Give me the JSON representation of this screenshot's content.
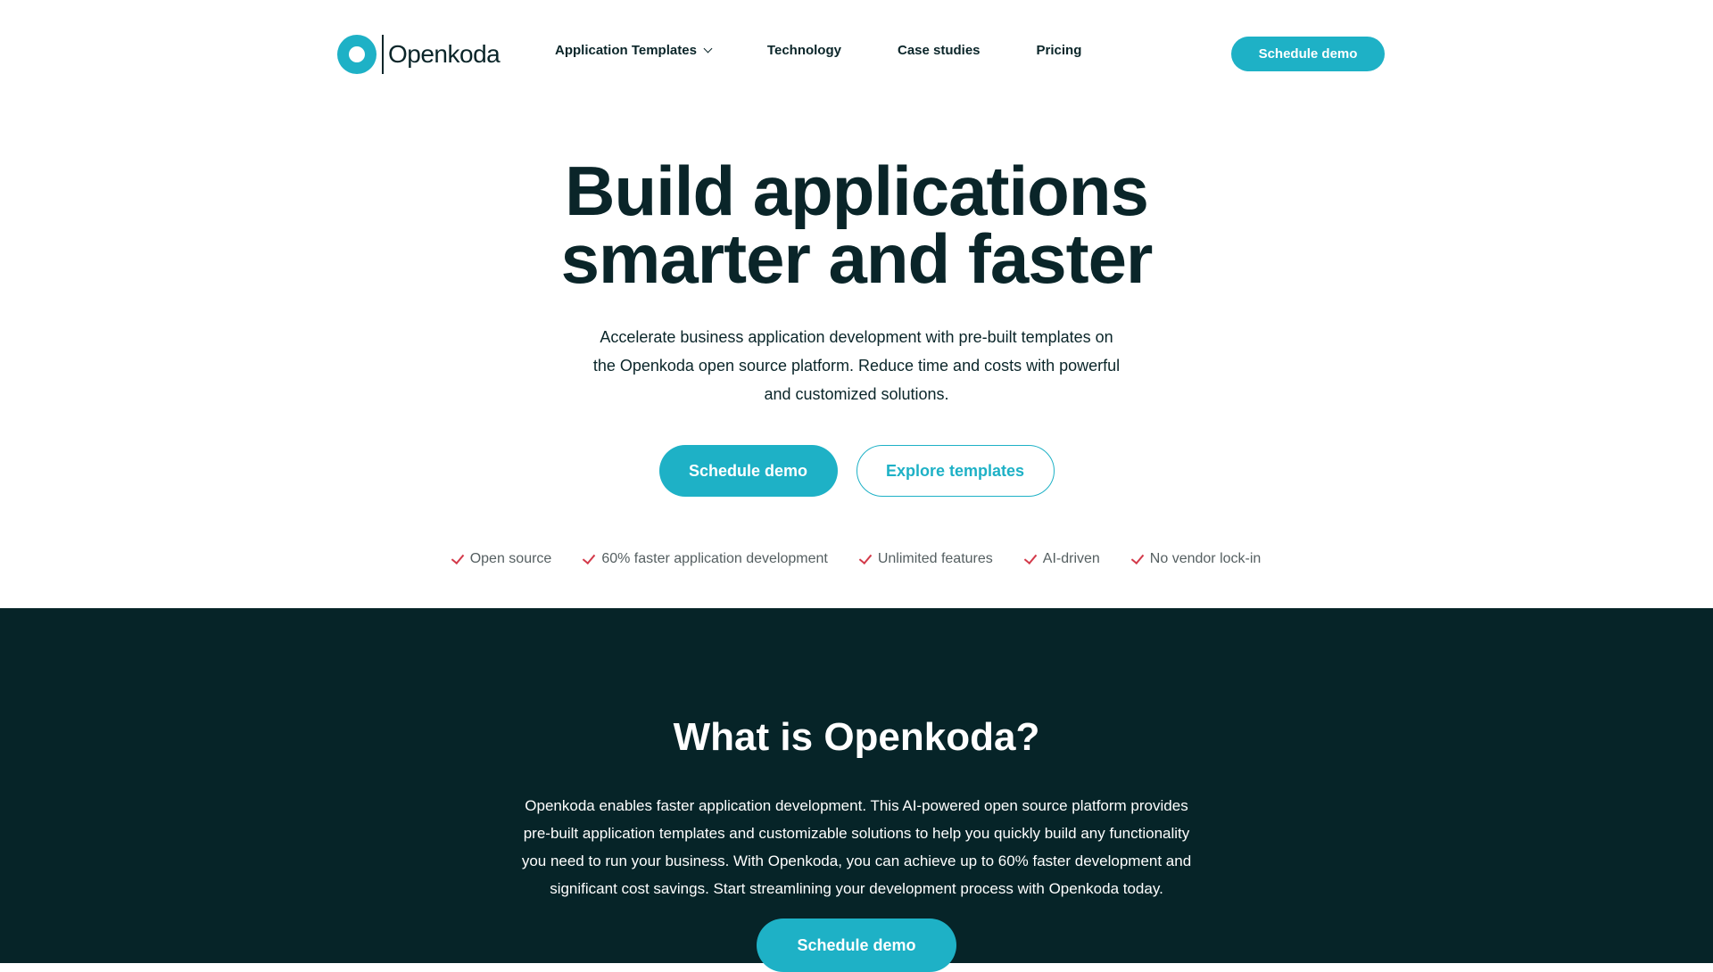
{
  "brand": {
    "name": "Openkoda",
    "accent": "#1eb1c6",
    "dark": "#062428",
    "check_color": "#d33a4a"
  },
  "nav": {
    "items": [
      {
        "label": "Application Templates",
        "icon": "chevron-down-icon"
      },
      {
        "label": "Technology"
      },
      {
        "label": "Case studies"
      },
      {
        "label": "Pricing"
      }
    ],
    "cta_label": "Schedule demo"
  },
  "hero": {
    "title_line1": "Build applications",
    "title_line2": "smarter and faster",
    "subtitle": "Accelerate business application development with pre-built templates on the Openkoda open source platform. Reduce time and costs with powerful and customized solutions.",
    "primary_label": "Schedule demo",
    "secondary_label": "Explore templates",
    "features": [
      "Open source",
      "60% faster application development",
      "Unlimited features",
      "AI-driven",
      "No vendor lock-in"
    ]
  },
  "about": {
    "title": "What is Openkoda?",
    "text": "Openkoda enables faster application development. This AI-powered open source platform provides pre-built application templates and customizable solutions to help you quickly build any functionality you need to run your business. With Openkoda, you can achieve up to 60% faster development and significant cost savings. Start streamlining your development process with Openkoda today.",
    "cta_label": "Schedule demo"
  }
}
